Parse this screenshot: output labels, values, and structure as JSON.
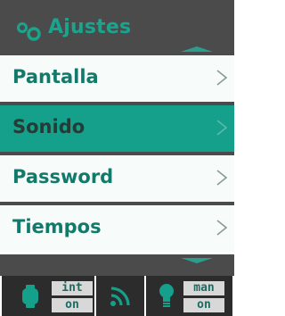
{
  "header": {
    "title": "Ajustes",
    "icon": "gear-icon"
  },
  "menu": {
    "items": [
      {
        "label": "Pantalla",
        "selected": false
      },
      {
        "label": "Sonido",
        "selected": true
      },
      {
        "label": "Password",
        "selected": false
      },
      {
        "label": "Tiempos",
        "selected": false
      }
    ]
  },
  "status": {
    "mode1_line1": "int",
    "mode1_line2": "on",
    "mode2_line1": "man",
    "mode2_line2": "on"
  },
  "colors": {
    "accent": "#14a08a",
    "header_bg": "#4b4b4b",
    "item_bg": "#f7fcfb",
    "label_text": "#127a6b"
  }
}
